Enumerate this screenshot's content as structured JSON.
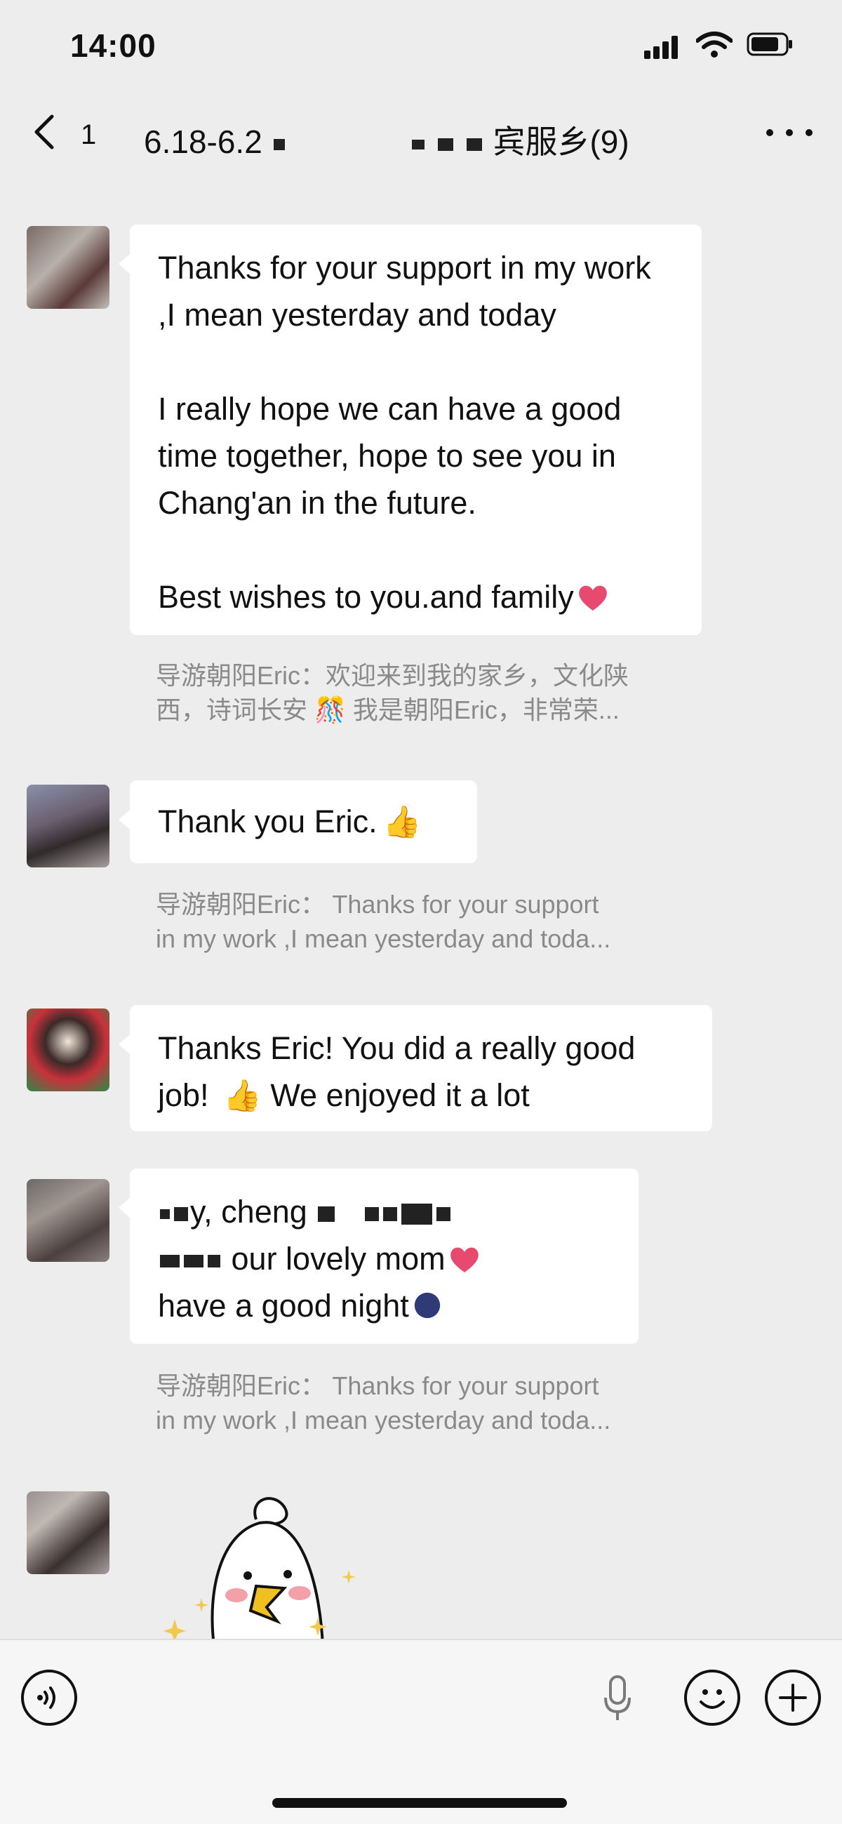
{
  "status_bar": {
    "time": "14:00"
  },
  "nav": {
    "back_count": "1",
    "title_start": "6.18-6.2",
    "title_end": "宾服乡",
    "member_count": "(9)"
  },
  "messages": [
    {
      "id": 1,
      "paragraphs": [
        "Thanks for your support in my work ,I mean yesterday and today",
        "I really hope we can have a good time together, hope to see you in Chang'an in the future.",
        "Best wishes to you.and family"
      ],
      "emoji": "heart-icon"
    },
    {
      "id": 2,
      "text": "Thank you Eric.",
      "emoji": "thumbs-up-icon"
    },
    {
      "id": 3,
      "text_a": "Thanks Eric! You did a really good job!",
      "text_b": "We enjoyed it a lot",
      "emoji": "thumbs-up-icon"
    },
    {
      "id": 4,
      "line1_visible": "y,  cheng",
      "line2_visible": "our lovely mom",
      "line3": "have a good night",
      "emoji": "heart-icon"
    }
  ],
  "quotes": [
    {
      "line1": "导游朝阳Eric：欢迎来到我的家乡，文化陕",
      "line2": "西，诗词长安 🎊 我是朝阳Eric，非常荣..."
    },
    {
      "line1": "导游朝阳Eric： Thanks for your support",
      "line2": "in my work ,I mean yesterday and toda..."
    },
    {
      "line1": "导游朝阳Eric： Thanks for your support",
      "line2": "in my work ,I mean yesterday and toda..."
    }
  ],
  "colors": {
    "background": "#ededed",
    "bubble": "#ffffff",
    "quote_text": "#8a8a8a",
    "heart": "#e84a6f"
  }
}
